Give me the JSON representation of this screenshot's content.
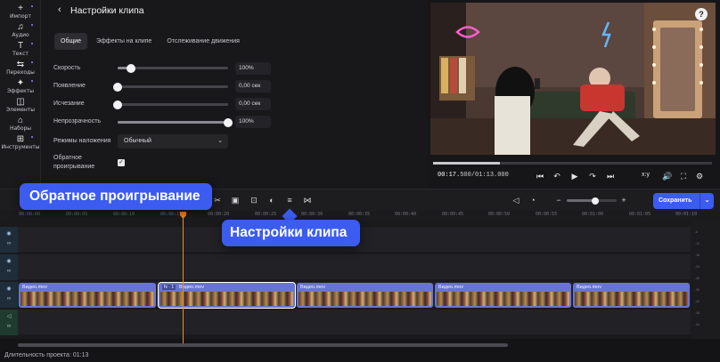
{
  "sidebar": {
    "items": [
      {
        "icon": "+",
        "label": "Импорт"
      },
      {
        "icon": "♫",
        "label": "Аудио"
      },
      {
        "icon": "T",
        "label": "Текст"
      },
      {
        "icon": "⇆",
        "label": "Переходы"
      },
      {
        "icon": "✦",
        "label": "Эффекты"
      },
      {
        "icon": "◫",
        "label": "Элементы"
      },
      {
        "icon": "⌂",
        "label": "Наборы"
      },
      {
        "icon": "⊞",
        "label": "Инструменты"
      }
    ]
  },
  "settings": {
    "back_icon": "‹",
    "title": "Настройки клипа",
    "tabs": [
      "Общие",
      "Эффекты на клипе",
      "Отслеживание движения"
    ],
    "rows": [
      {
        "label": "Скорость",
        "value": "100%",
        "fraction": 0.12
      },
      {
        "label": "Появление",
        "value": "0,00 сек",
        "fraction": 0.0
      },
      {
        "label": "Исчезание",
        "value": "0,00 сек",
        "fraction": 0.0
      },
      {
        "label": "Непрозрачность",
        "value": "100%",
        "fraction": 1.0
      }
    ],
    "blend_label": "Режимы наложения",
    "blend_value": "Обычный",
    "reverse_label_1": "Обратное",
    "reverse_label_2": "проигрывание",
    "reverse_checked": "✓"
  },
  "preview": {
    "help": "?",
    "current_time": "00:17.",
    "current_ms": "500",
    "total_time": "/01:13.000",
    "progress": 0.24,
    "ratio": "x:y"
  },
  "toolbar": {
    "save_label": "Сохранить",
    "save_chevron": "⌄",
    "zoom": 0.58
  },
  "ruler": {
    "ticks": [
      "00:00:00",
      "00:00:05",
      "00:00:10",
      "00:00:15",
      "00:00:20",
      "00:00:25",
      "00:00:30",
      "00:00:35",
      "00:00:40",
      "00:00:45",
      "00:00:50",
      "00:00:55",
      "00:01:00",
      "00:01:05",
      "00:01:10"
    ]
  },
  "clips": [
    {
      "label": "Видео.mov",
      "fx": ""
    },
    {
      "label": "Видео.mov",
      "fx": "fx · 1"
    },
    {
      "label": "Видео.mov",
      "fx": ""
    },
    {
      "label": "Видео.mov",
      "fx": ""
    },
    {
      "label": "Видео.mov",
      "fx": ""
    }
  ],
  "meter": {
    "ticks": [
      "-6",
      "-12",
      "-18",
      "-24",
      "-30",
      "-36",
      "-42",
      "-48",
      "-54"
    ]
  },
  "footer": {
    "duration": "Длительность проекта: 01:13"
  },
  "callouts": {
    "reverse": "Обратное проигрывание",
    "clip_settings": "Настройки клипа"
  },
  "colors": {
    "accent": "#3c5cf0",
    "playhead": "#f08a24",
    "clip": "#6973d6"
  }
}
